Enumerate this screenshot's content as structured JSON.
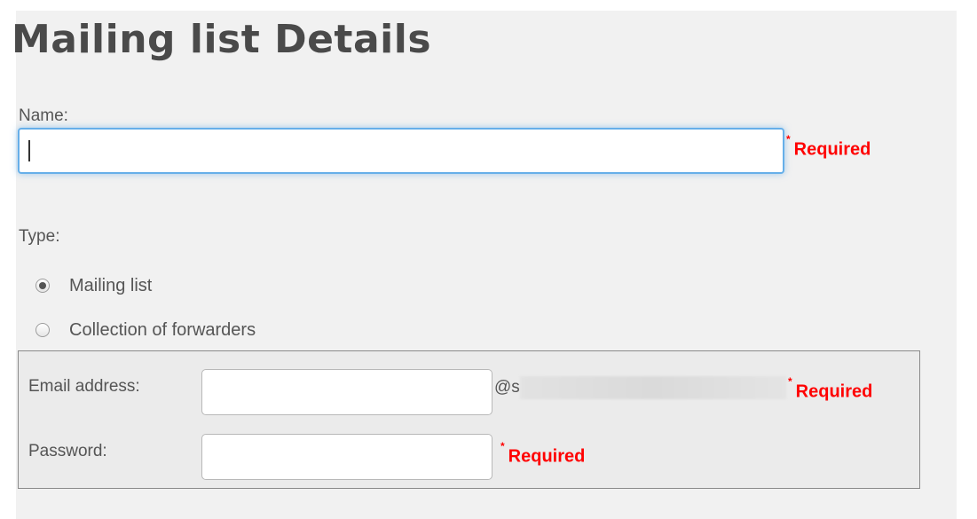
{
  "form": {
    "title": "Mailing list Details",
    "name_label": "Name:",
    "name_value": "",
    "required_text": "Required",
    "required_mark": "*",
    "type_label": "Type:",
    "type_options": [
      {
        "label": "Mailing list",
        "selected": true
      },
      {
        "label": "Collection of forwarders",
        "selected": false
      }
    ],
    "email_label": "Email address:",
    "email_value": "",
    "domain_prefix": "@s",
    "password_label": "Password:",
    "password_value": ""
  },
  "colors": {
    "required": "#ff0000",
    "focus_border": "#66afe9",
    "panel_background": "#f1f1f1",
    "text": "#555555",
    "title": "#4a4a4a"
  }
}
